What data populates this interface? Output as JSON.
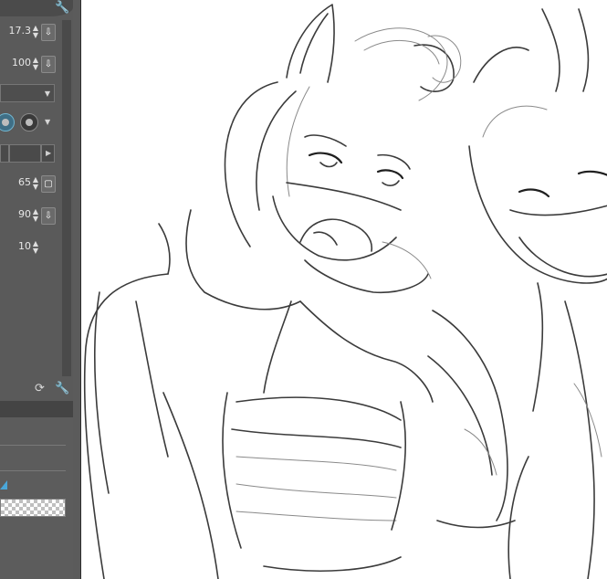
{
  "tool_property": {
    "brush_size": "17.3",
    "brush_opacity": "100",
    "hardness": "65",
    "density": "90",
    "stabilization": "10"
  },
  "icons": {
    "settings_wrench": "wrench-icon",
    "lock": "lock-icon",
    "reset": "reset-icon"
  },
  "colors": {
    "panel_bg": "#5a5a5a",
    "canvas_bg": "#ffffff",
    "accent_blue": "#4aa6d8"
  }
}
